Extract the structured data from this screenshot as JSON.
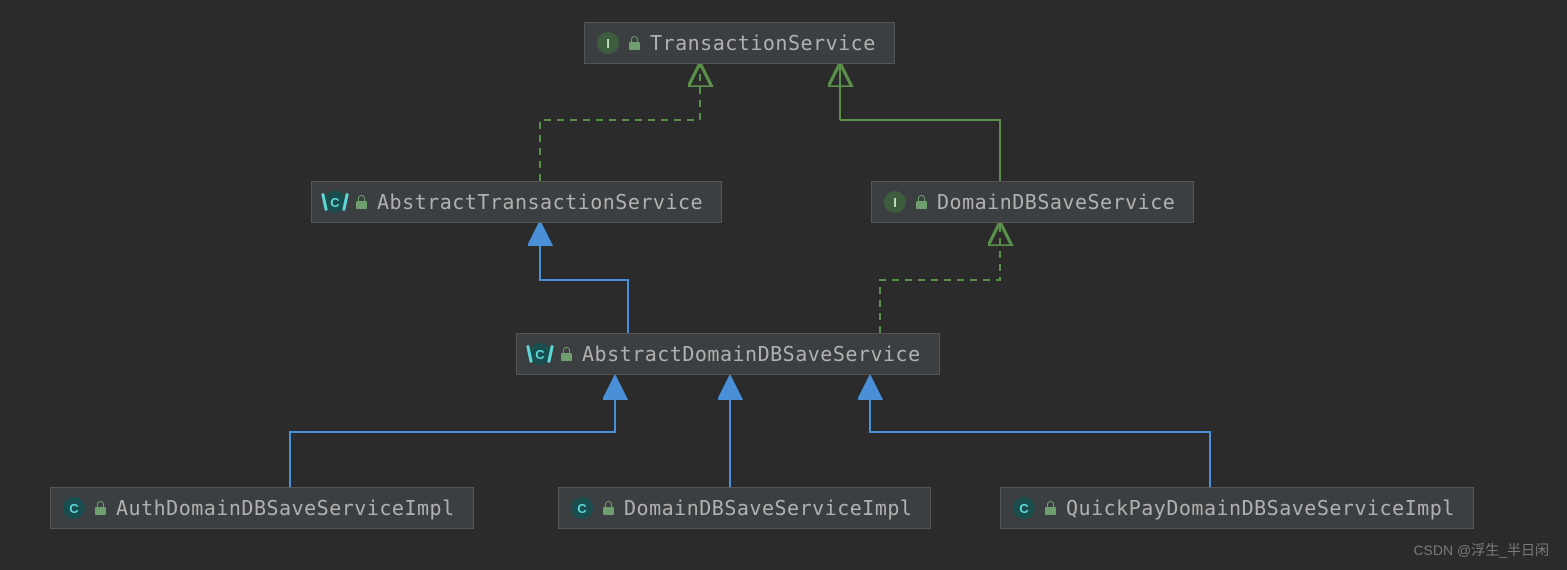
{
  "colors": {
    "background": "#2b2b2b",
    "node_fill": "#3c3f41",
    "node_border": "#555555",
    "text": "#b0b0b0",
    "implements_line": "#5a8f4a",
    "extends_line": "#4a90d9",
    "interface_badge": "#3e5c3e",
    "class_badge": "#1a4d4d",
    "lock": "#6f9e6f"
  },
  "nodes": {
    "transaction_service": {
      "label": "TransactionService",
      "kind": "interface",
      "visibility": "locked"
    },
    "abstract_transaction_service": {
      "label": "AbstractTransactionService",
      "kind": "abstract-class",
      "visibility": "locked"
    },
    "domain_db_save_service": {
      "label": "DomainDBSaveService",
      "kind": "interface",
      "visibility": "locked"
    },
    "abstract_domain_db_save_service": {
      "label": "AbstractDomainDBSaveService",
      "kind": "abstract-class",
      "visibility": "locked"
    },
    "auth_domain_db_save_service_impl": {
      "label": "AuthDomainDBSaveServiceImpl",
      "kind": "class",
      "visibility": "locked"
    },
    "domain_db_save_service_impl": {
      "label": "DomainDBSaveServiceImpl",
      "kind": "class",
      "visibility": "locked"
    },
    "quickpay_domain_db_save_service_impl": {
      "label": "QuickPayDomainDBSaveServiceImpl",
      "kind": "class",
      "visibility": "locked"
    }
  },
  "edges": [
    {
      "from": "abstract_transaction_service",
      "to": "transaction_service",
      "type": "implements"
    },
    {
      "from": "domain_db_save_service",
      "to": "transaction_service",
      "type": "extends-interface"
    },
    {
      "from": "abstract_domain_db_save_service",
      "to": "abstract_transaction_service",
      "type": "extends"
    },
    {
      "from": "abstract_domain_db_save_service",
      "to": "domain_db_save_service",
      "type": "implements"
    },
    {
      "from": "auth_domain_db_save_service_impl",
      "to": "abstract_domain_db_save_service",
      "type": "extends"
    },
    {
      "from": "domain_db_save_service_impl",
      "to": "abstract_domain_db_save_service",
      "type": "extends"
    },
    {
      "from": "quickpay_domain_db_save_service_impl",
      "to": "abstract_domain_db_save_service",
      "type": "extends"
    }
  ],
  "badges": {
    "interface": "I",
    "abstract-class": "C",
    "class": "C"
  },
  "watermark": "CSDN @浮生_半日闲"
}
